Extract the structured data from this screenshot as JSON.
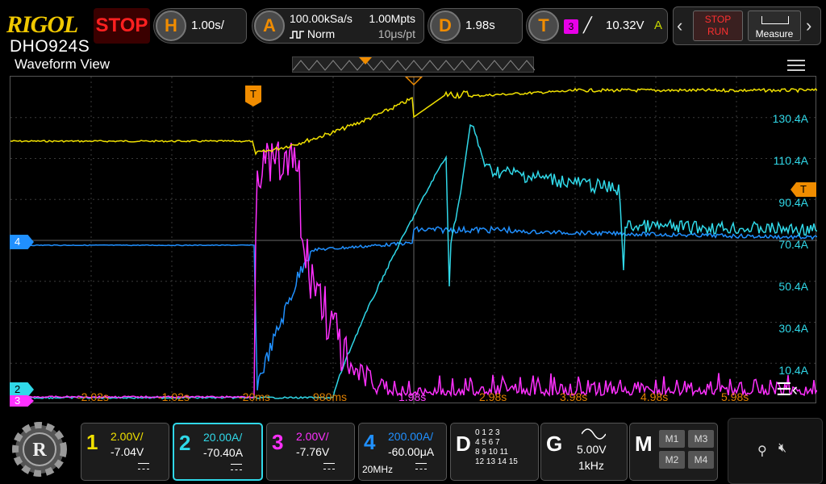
{
  "brand": {
    "logo": "RIGOL",
    "model": "DHO924S"
  },
  "run_state": "STOP",
  "horizontal": {
    "letter": "H",
    "timebase": "1.00s/"
  },
  "acquire": {
    "letter": "A",
    "sample_rate": "100.00kSa/s",
    "mode": "Norm",
    "memory_depth": "1.00Mpts",
    "resolution": "10μs/pt"
  },
  "delay": {
    "letter": "D",
    "value": "1.98s"
  },
  "trigger": {
    "letter": "T",
    "source": "3",
    "level": "10.32V",
    "sweep": "A"
  },
  "controls": {
    "stop_run_top": "STOP",
    "stop_run_bottom": "RUN",
    "measure": "Measure"
  },
  "view": {
    "title": "Waveform View"
  },
  "amp_labels": [
    "130.4A",
    "110.4A",
    "90.4A",
    "70.4A",
    "50.4A",
    "30.4A",
    "10.4A"
  ],
  "time_labels": [
    "-2.02s",
    "-1.02s",
    "-20ms",
    "980ms",
    "1.98s",
    "2.98s",
    "3.98s",
    "4.98s",
    "5.98s"
  ],
  "markers": {
    "ch4": "4",
    "ch2": "2",
    "ch3": "3",
    "trigger": "T"
  },
  "channels": [
    {
      "num": "1",
      "scale": "2.00V/",
      "offset": "-7.04V",
      "color": "#f0e000",
      "selected": false,
      "bw": ""
    },
    {
      "num": "2",
      "scale": "20.00A/",
      "offset": "-70.40A",
      "color": "#30d8e8",
      "selected": true,
      "bw": ""
    },
    {
      "num": "3",
      "scale": "2.00V/",
      "offset": "-7.76V",
      "color": "#ff30ff",
      "selected": false,
      "bw": ""
    },
    {
      "num": "4",
      "scale": "200.00A/",
      "offset": "-60.00μA",
      "color": "#2090ff",
      "selected": false,
      "bw": "20MHz"
    }
  ],
  "digital": {
    "letter": "D",
    "rows": [
      "0  1  2  3",
      "4  5  6  7",
      "8  9  10  11",
      "12  13  14  15"
    ]
  },
  "generator": {
    "letter": "G",
    "amplitude": "5.00V",
    "frequency": "1kHz"
  },
  "math": {
    "letter": "M",
    "items": [
      "M1",
      "M3",
      "M2",
      "M4"
    ]
  },
  "colors": {
    "ch1": "#f0e000",
    "ch2": "#30d8e8",
    "ch3": "#ff30ff",
    "ch4": "#2090ff",
    "trigger": "#f08c00",
    "stop": "#ff2020"
  }
}
